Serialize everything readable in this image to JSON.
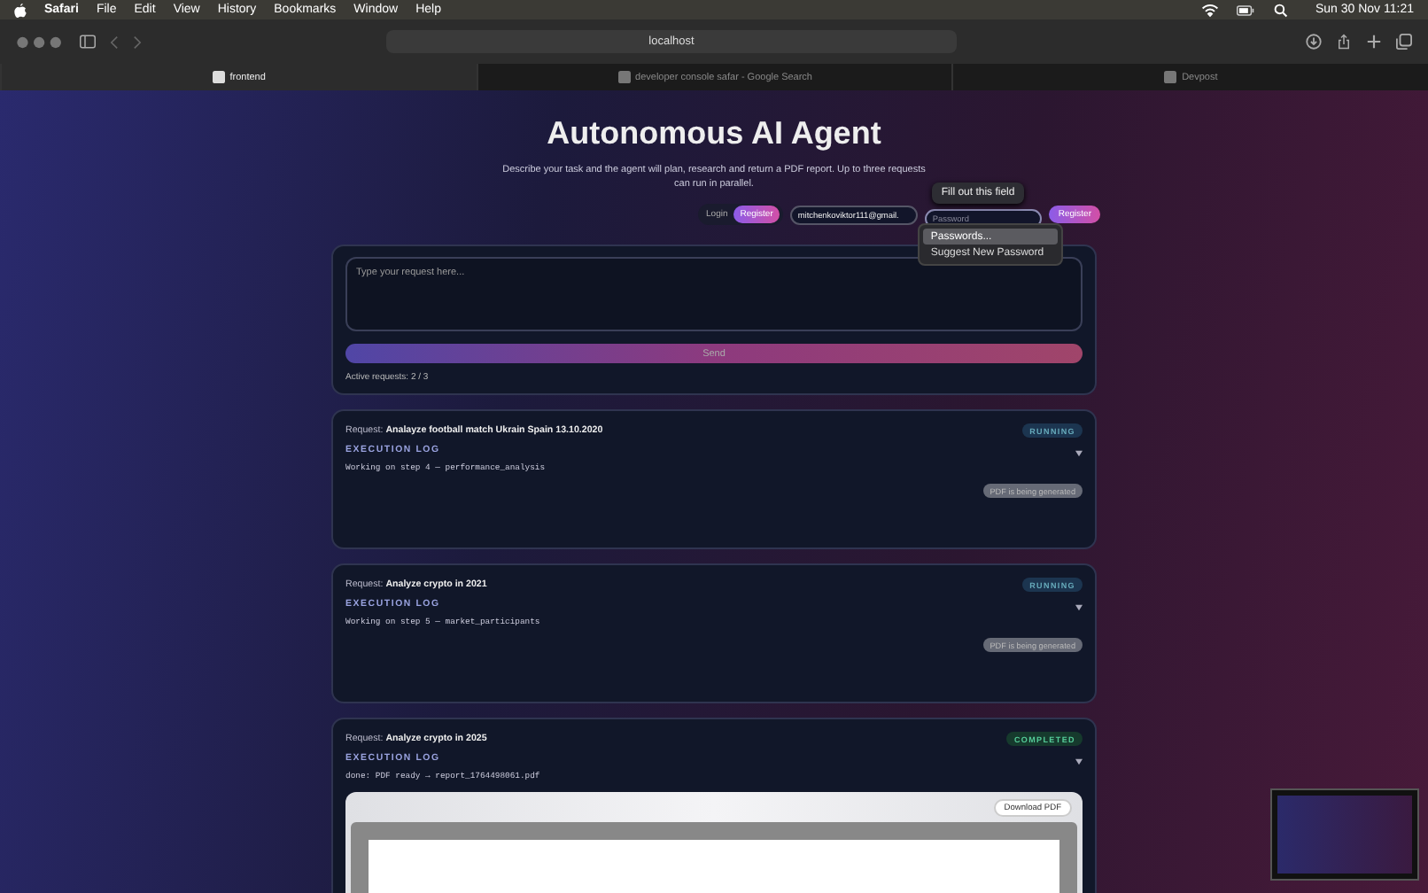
{
  "menu_bar": {
    "app": "Safari",
    "items": [
      "File",
      "Edit",
      "View",
      "History",
      "Bookmarks",
      "Window",
      "Help"
    ],
    "clock": "Sun 30 Nov  11:21"
  },
  "toolbar": {
    "address": "localhost"
  },
  "tabs": [
    {
      "label": "frontend",
      "selected": true
    },
    {
      "label": "developer console safar - Google Search",
      "selected": false
    },
    {
      "label": "Devpost",
      "selected": false
    }
  ],
  "page": {
    "title": "Autonomous AI Agent",
    "subtitle": "Describe your task and the agent will plan, research and return a PDF report. Up to three requests can run in parallel.",
    "auth": {
      "login": "Login",
      "register_tab": "Register",
      "email_value": "mitchenkoviktor111@gmail.",
      "password_placeholder": "Password",
      "register_button": "Register"
    },
    "tooltip": "Fill out this field",
    "autofill_menu": [
      {
        "label": "Passwords...",
        "selected": true
      },
      {
        "label": "Suggest New Password",
        "selected": false
      }
    ],
    "composer": {
      "placeholder": "Type your request here...",
      "send": "Send",
      "active": "Active requests: 2 / 3"
    },
    "requests": [
      {
        "kind": "running",
        "prefix": "Request:",
        "query": "Analayze football match Ukrain Spain 13.10.2020",
        "status": "RUNNING",
        "log_title": "EXECUTION LOG",
        "log": "Working on step 4 — performance_analysis",
        "pdf_note": "PDF is being generated"
      },
      {
        "kind": "running",
        "prefix": "Request:",
        "query": "Analyze crypto in 2021",
        "status": "RUNNING",
        "log_title": "EXECUTION LOG",
        "log": "Working on step 5 — market_participants",
        "pdf_note": "PDF is being generated"
      },
      {
        "kind": "completed",
        "prefix": "Request:",
        "query": "Analyze crypto in 2025",
        "status": "COMPLETED",
        "log_title": "EXECUTION LOG",
        "log": "done: PDF ready → report_1764498061.pdf",
        "download": "Download PDF"
      }
    ]
  }
}
